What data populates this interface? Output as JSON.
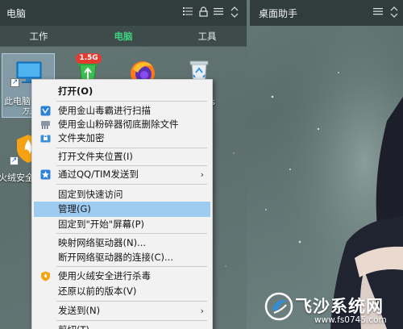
{
  "left_fence": {
    "title": "电脑",
    "tabs": [
      {
        "label": "工作"
      },
      {
        "label": "电脑"
      },
      {
        "label": "工具"
      }
    ],
    "icons": [
      {
        "label": "此电脑",
        "sub": "万王"
      },
      {
        "label": "",
        "badge": "1.5G"
      },
      {
        "label": ""
      },
      {
        "label": "",
        "sub": "s"
      },
      {
        "label": "火绒安全"
      }
    ]
  },
  "right_fence": {
    "title": "桌面助手"
  },
  "context_menu": {
    "items": [
      {
        "label": "打开(O)"
      },
      {
        "label": "使用金山毒霸进行扫描"
      },
      {
        "label": "使用金山粉碎器彻底删除文件"
      },
      {
        "label": "文件夹加密"
      },
      {
        "label": "打开文件夹位置(I)"
      },
      {
        "label": "通过QQ/TIM发送到"
      },
      {
        "label": "固定到快速访问"
      },
      {
        "label": "管理(G)"
      },
      {
        "label": "固定到\"开始\"屏幕(P)"
      },
      {
        "label": "映射网络驱动器(N)..."
      },
      {
        "label": "断开网络驱动器的连接(C)..."
      },
      {
        "label": "使用火绒安全进行杀毒"
      },
      {
        "label": "还原以前的版本(V)"
      },
      {
        "label": "发送到(N)"
      },
      {
        "label": "剪切(T)"
      }
    ],
    "submenu_arrow": "›"
  },
  "watermark": {
    "title": "飞沙系统网",
    "url": "www.fs0745.com"
  },
  "colors": {
    "accent_green": "#3ed17d",
    "menu_highlight": "#9ecbf0",
    "badge_red": "#e43a2f"
  }
}
